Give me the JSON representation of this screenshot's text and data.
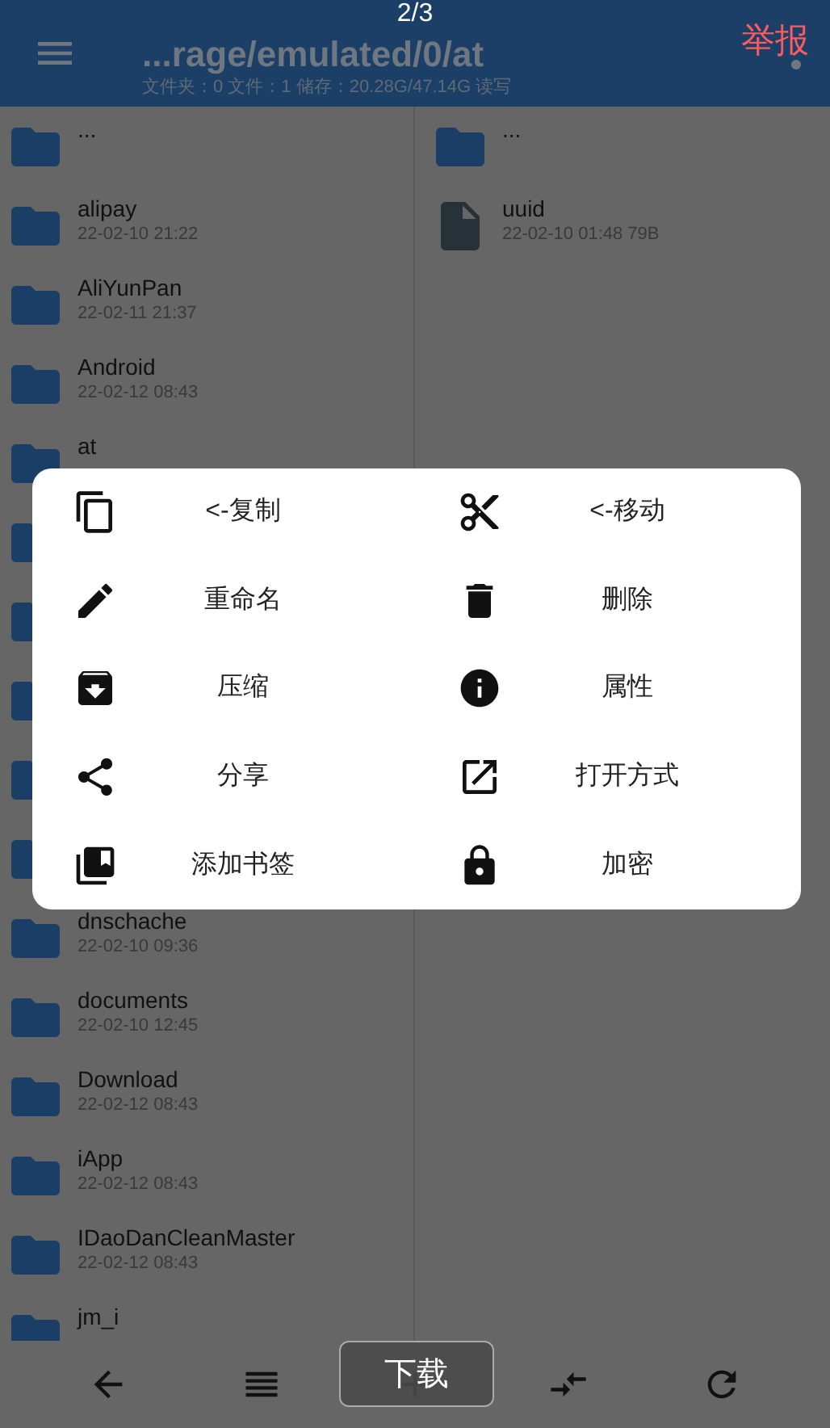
{
  "header": {
    "title": "...rage/emulated/0/at",
    "subtitle": "文件夹：0 文件：1  储存：20.28G/47.14G   读写"
  },
  "viewer": {
    "counter": "2/3",
    "report": "举报",
    "download": "下载"
  },
  "left_pane": [
    {
      "kind": "folder",
      "name": "..."
    },
    {
      "kind": "folder",
      "name": "alipay",
      "date": "22-02-10 21:22"
    },
    {
      "kind": "folder",
      "name": "AliYunPan",
      "date": "22-02-11 21:37"
    },
    {
      "kind": "folder",
      "name": "Android",
      "date": "22-02-12 08:43"
    },
    {
      "kind": "folder",
      "name": "at"
    },
    {
      "kind": "folder"
    },
    {
      "kind": "folder"
    },
    {
      "kind": "folder"
    },
    {
      "kind": "folder"
    },
    {
      "kind": "folder"
    },
    {
      "kind": "folder",
      "name": "dnschache",
      "date": "22-02-10 09:36"
    },
    {
      "kind": "folder",
      "name": "documents",
      "date": "22-02-10 12:45"
    },
    {
      "kind": "folder",
      "name": "Download",
      "date": "22-02-12 08:43"
    },
    {
      "kind": "folder",
      "name": "iApp",
      "date": "22-02-12 08:43"
    },
    {
      "kind": "folder",
      "name": "IDaoDanCleanMaster",
      "date": "22-02-12 08:43"
    },
    {
      "kind": "folder",
      "name": "jm_i"
    }
  ],
  "right_pane": [
    {
      "kind": "folder",
      "name": "..."
    },
    {
      "kind": "file",
      "name": "uuid",
      "date": "22-02-10 01:48  79B"
    }
  ],
  "actions": [
    "<-复制",
    "<-移动",
    "重命名",
    "删除",
    "压缩",
    "属性",
    "分享",
    "打开方式",
    "添加书签",
    "加密"
  ]
}
